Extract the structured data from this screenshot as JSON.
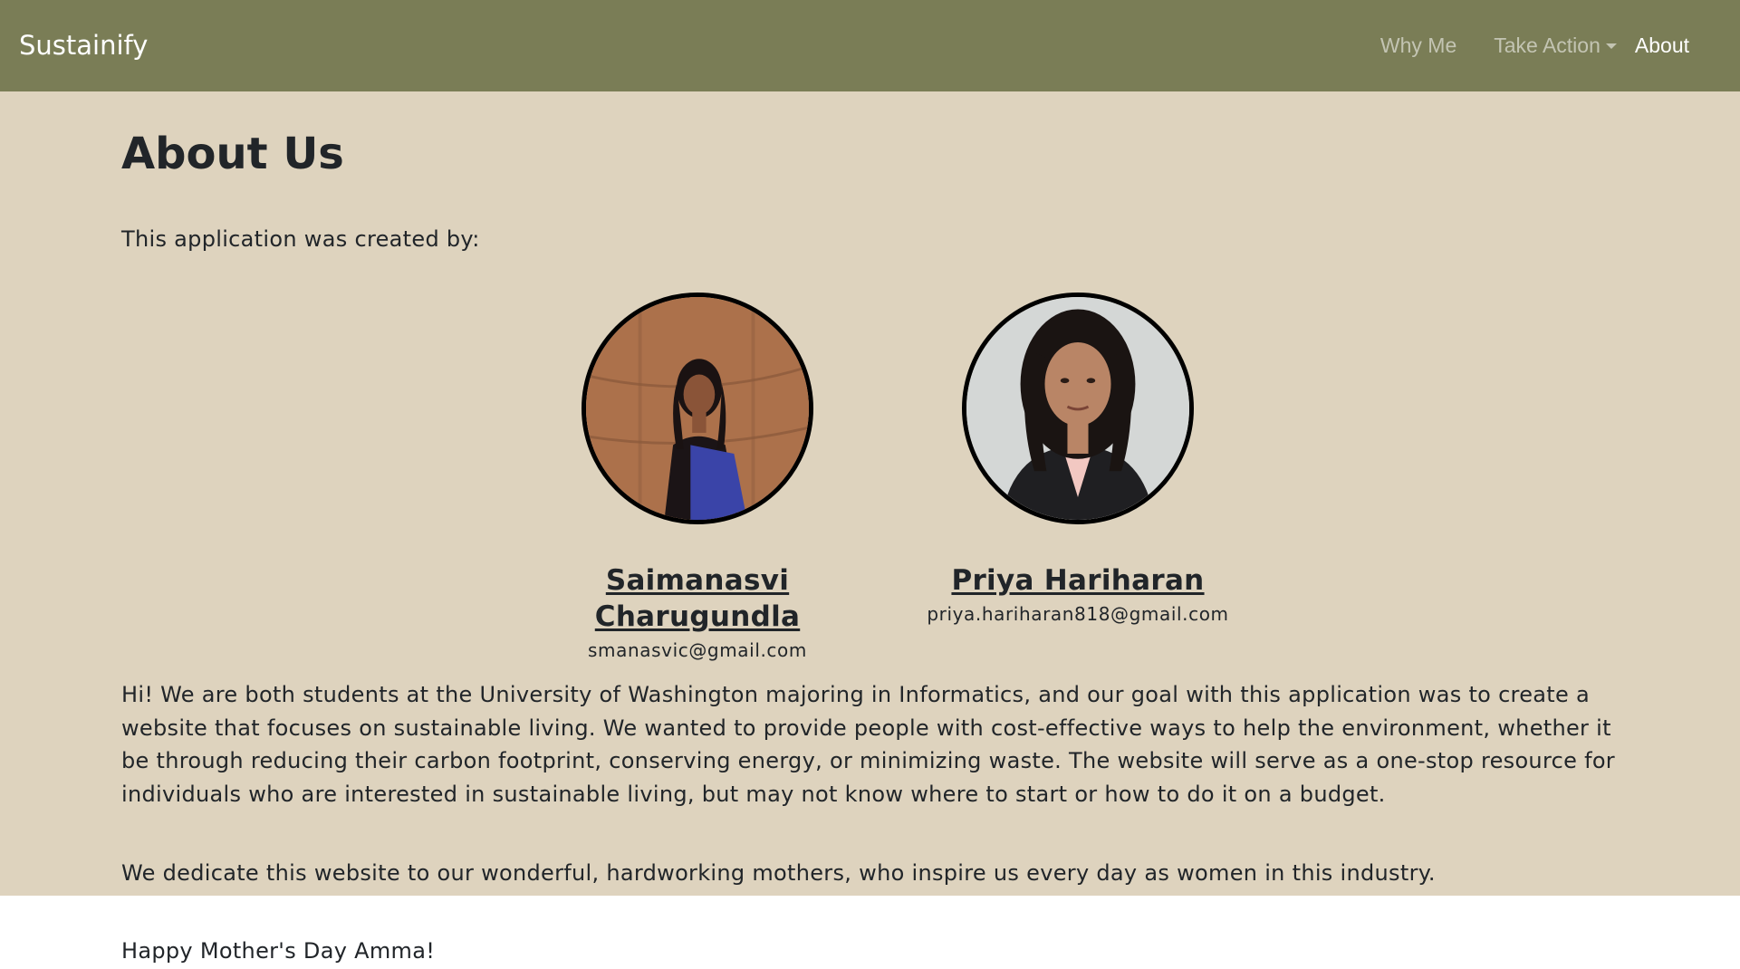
{
  "nav": {
    "brand": "Sustainify",
    "links": [
      {
        "label": "Why Me"
      },
      {
        "label": "Take Action",
        "dropdown": true
      },
      {
        "label": "About",
        "active": true
      }
    ]
  },
  "main": {
    "title": "About Us",
    "intro": "This application was created by:",
    "members": [
      {
        "name": "Saimanasvi Charugundla",
        "email": "smanasvic@gmail.com"
      },
      {
        "name": "Priya Hariharan",
        "email": "priya.hariharan818@gmail.com"
      }
    ],
    "paragraphs": [
      "Hi! We are both students at the University of Washington majoring in Informatics, and our goal with this application was to create a website that focuses on sustainable living. We wanted to provide people with cost-effective ways to help the environment, whether it be through reducing their carbon footprint, conserving energy, or minimizing waste. The website will serve as a one-stop resource for individuals who are interested in sustainable living, but may not know where to start or how to do it on a budget.",
      "We dedicate this website to our wonderful, hardworking mothers, who inspire us every day as women in this industry."
    ],
    "closing": "Happy Mother's Day Amma!"
  },
  "colors": {
    "navbar": "#7a7d56",
    "content_bg": "#ded3be",
    "text": "#212529"
  }
}
